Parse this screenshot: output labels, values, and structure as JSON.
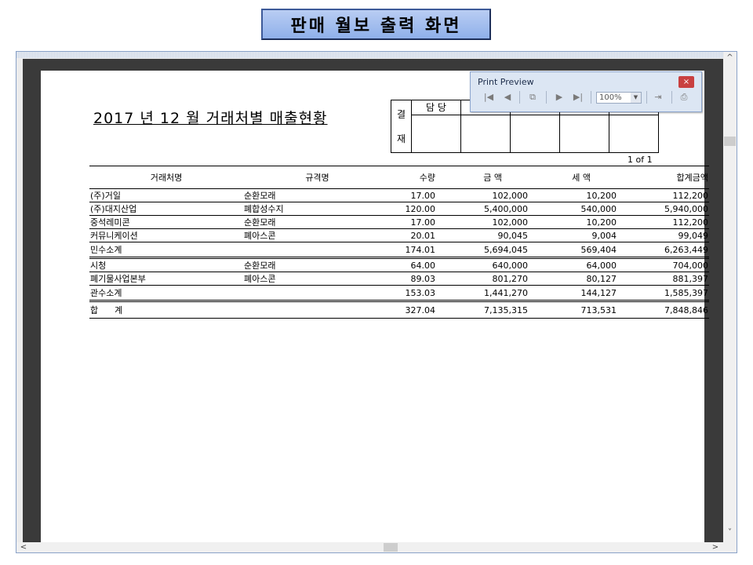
{
  "banner": {
    "title": "판매 월보 출력 화면"
  },
  "report": {
    "title": "2017 년 12 월 거래처별 매출현황",
    "approval": {
      "label_top": "결",
      "label_bottom": "재",
      "first_header": "담 당"
    },
    "page_indicator": "1 of   1",
    "columns": [
      "거래처명",
      "규격명",
      "수량",
      "금 액",
      "세 액",
      "합계금액"
    ],
    "group1": {
      "rows": [
        [
          "(주)거일",
          "순환모래",
          "17.00",
          "102,000",
          "10,200",
          "112,200"
        ],
        [
          "(주)대지산업",
          "폐합성수지",
          "120.00",
          "5,400,000",
          "540,000",
          "5,940,000"
        ],
        [
          "중석레미콘",
          "순환모래",
          "17.00",
          "102,000",
          "10,200",
          "112,200"
        ],
        [
          "커뮤니케이션",
          "폐아스콘",
          "20.01",
          "90,045",
          "9,004",
          "99,049"
        ]
      ],
      "subtotal": [
        "민수소계",
        "",
        "174.01",
        "5,694,045",
        "569,404",
        "6,263,449"
      ]
    },
    "group2": {
      "rows": [
        [
          "시청",
          "순환모래",
          "64.00",
          "640,000",
          "64,000",
          "704,000"
        ],
        [
          "폐기물사업본부",
          "폐아스콘",
          "89.03",
          "801,270",
          "80,127",
          "881,397"
        ]
      ],
      "subtotal": [
        "관수소계",
        "",
        "153.03",
        "1,441,270",
        "144,127",
        "1,585,397"
      ]
    },
    "total": [
      "합      계",
      "",
      "327.04",
      "7,135,315",
      "713,531",
      "7,848,846"
    ]
  },
  "print_preview": {
    "title": "Print Preview",
    "close": "×",
    "zoom": "100%",
    "icons": [
      "first-page-icon",
      "prev-page-icon",
      "copy-icon",
      "next-page-icon",
      "last-page-icon",
      "export-icon",
      "print-icon"
    ]
  },
  "scrollbars": {
    "up": "^",
    "down": "˅",
    "left": "<",
    "right": ">"
  }
}
